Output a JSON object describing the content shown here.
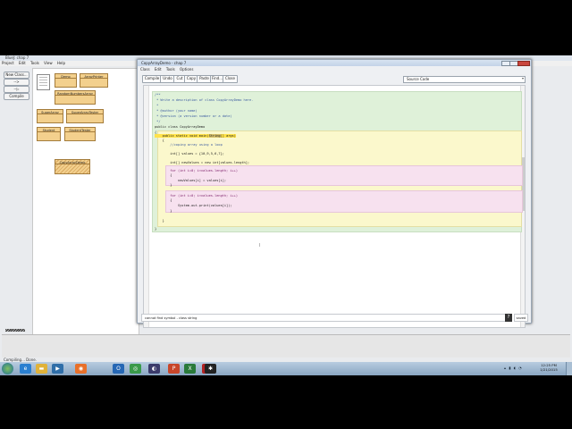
{
  "bluej": {
    "title": "BlueJ: chap 7",
    "menu": [
      "Project",
      "Edit",
      "Tools",
      "View",
      "Help"
    ],
    "buttons": {
      "new_class": "New Class...",
      "arrow1": "-->",
      "arrow2": "--▷",
      "compile": "Compile"
    },
    "classes": [
      "Demo",
      "ArrayPrinter",
      "RandomNumbersArray",
      "SuperArray",
      "SuperArrayTester",
      "Student",
      "StudentTester",
      "CopyArrayDemo"
    ],
    "status": "Compiling... Done."
  },
  "editor": {
    "title": "CopyArrayDemo - chap 7",
    "menu": [
      "Class",
      "Edit",
      "Tools",
      "Options"
    ],
    "toolbar": [
      "Compile",
      "Undo",
      "Cut",
      "Copy",
      "Paste",
      "Find...",
      "Close"
    ],
    "view_select": "Source Code",
    "message": "cannot find symbol -   class string",
    "help": "?",
    "saved": "saved"
  },
  "code": {
    "c1": "/**",
    "c2": " * Write a description of class CopyArrayDemo here.",
    "c3": " *",
    "c4": " * @author (your name)",
    "c5": " * @version (a version number or a date)",
    "c6": " */",
    "class_decl": "public class CopyArrayDemo",
    "open": "{",
    "main_a": "    public static void main(",
    "main_err": "String",
    "main_b": "[] args)",
    "mopen": "    {",
    "comment_line": "        //coping array using a loop",
    "values_line": "        int[] values = {10,9,5,6,7};",
    "newvalues_line": "        int[] newValues = new int[values.length];",
    "for1": "        for (int i=0; i<values.length; i++)",
    "for1_open": "        {",
    "for1_body": "            newValues[i] = values[i];",
    "for1_close": "        }",
    "for2": "        for (int i=0; i<values.length; i++)",
    "for2_open": "        {",
    "for2_body": "            System.out.print(values[i]);",
    "for2_close": "        }",
    "mclose": "    }",
    "close": "}"
  },
  "taskbar": {
    "clock_time": "12:25 PM",
    "clock_date": "1/21/2015",
    "icons": [
      "ie-icon",
      "folder-icon",
      "media-player-icon",
      "firefox-icon",
      "outlook-icon",
      "chrome-icon",
      "eclipse-icon",
      "powerpoint-icon",
      "excel-icon",
      "adobe-reader-icon",
      "bluej-icon"
    ]
  }
}
